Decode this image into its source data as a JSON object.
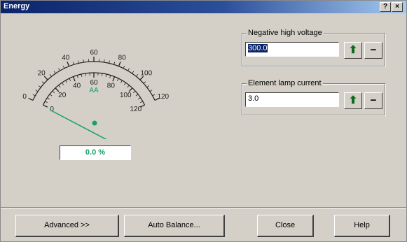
{
  "window": {
    "title": "Energy",
    "help_glyph": "?",
    "close_glyph": "×"
  },
  "gauge": {
    "outer_labels": [
      "0",
      "20",
      "40",
      "60",
      "80",
      "100",
      "120"
    ],
    "inner_labels": [
      "0",
      "20",
      "40",
      "60",
      "80",
      "100",
      "120"
    ],
    "unit": "AA",
    "readout": "0.0 %"
  },
  "negative_high_voltage": {
    "label": "Negative high voltage",
    "value": "300.0"
  },
  "element_lamp_current": {
    "label": "Element lamp current",
    "value": "3.0"
  },
  "buttons": {
    "advanced": "Advanced >>",
    "auto_balance": "Auto Balance...",
    "close": "Close",
    "help": "Help"
  },
  "icons": {
    "increment": "up-arrow-icon",
    "decrement": "minus-icon"
  },
  "colors": {
    "title_bar": "#0a246a",
    "dialog_face": "#d4d0c8",
    "indicator_green": "#17a06a",
    "increment_arrow": "#0e6b1a"
  }
}
